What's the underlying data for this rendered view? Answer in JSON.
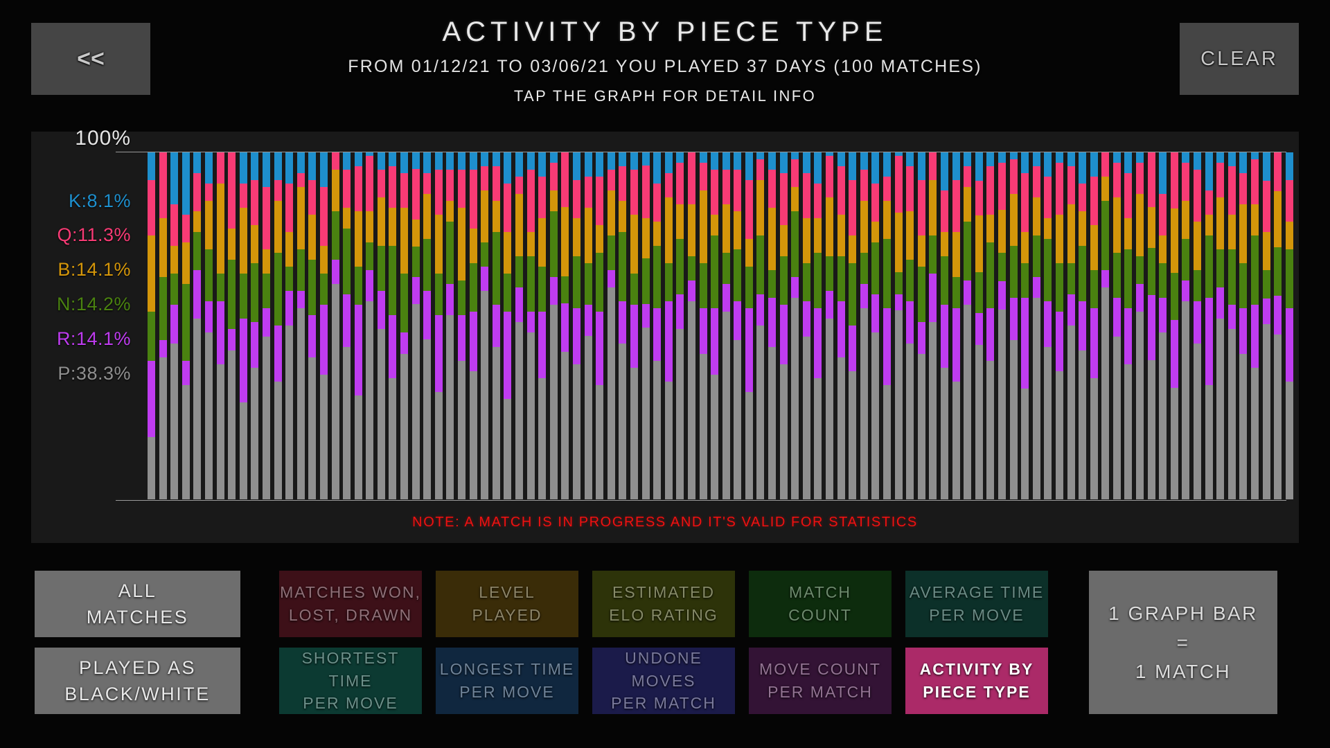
{
  "header": {
    "back_label": "<<",
    "clear_label": "CLEAR",
    "title": "ACTIVITY BY PIECE TYPE",
    "subtitle": "FROM 01/12/21 TO 03/06/21 YOU PLAYED 37 DAYS (100 MATCHES)",
    "hint": "TAP THE GRAPH FOR DETAIL INFO"
  },
  "chart": {
    "axis_top_label": "100%",
    "note": "NOTE: A MATCH IS IN PROGRESS AND IT'S VALID FOR STATISTICS"
  },
  "legend": [
    {
      "key": "K",
      "label": "K:8.1%",
      "color": "#1e8fcd",
      "name": "king"
    },
    {
      "key": "Q",
      "label": "Q:11.3%",
      "color": "#f83b75",
      "name": "queen"
    },
    {
      "key": "B",
      "label": "B:14.1%",
      "color": "#d4960a",
      "name": "bishop"
    },
    {
      "key": "N",
      "label": "N:14.2%",
      "color": "#4a8210",
      "name": "knight"
    },
    {
      "key": "R",
      "label": "R:14.1%",
      "color": "#bf3cf0",
      "name": "rook"
    },
    {
      "key": "P",
      "label": "P:38.3%",
      "color": "#8f8f8f",
      "name": "pawn"
    }
  ],
  "bottom_buttons": {
    "modes": [
      {
        "id": "all-matches",
        "lines": [
          "ALL",
          "MATCHES"
        ],
        "bg": "#6e6e6e",
        "fg": "#e8e8e8"
      },
      {
        "id": "played-as-color",
        "lines": [
          "PLAYED AS",
          "BLACK/WHITE"
        ],
        "bg": "#6e6e6e",
        "fg": "#e8e8e8"
      }
    ],
    "stats": [
      {
        "id": "matches-won-lost-drawn",
        "lines": [
          "MATCHES WON,",
          "LOST, DRAWN"
        ],
        "bg": "#3d1018",
        "fg": "#8f7078",
        "active": false
      },
      {
        "id": "level-played",
        "lines": [
          "LEVEL",
          "PLAYED"
        ],
        "bg": "#3a2c08",
        "fg": "#8c8468",
        "active": false
      },
      {
        "id": "estimated-elo-rating",
        "lines": [
          "ESTIMATED",
          "ELO RATING"
        ],
        "bg": "#2d3309",
        "fg": "#868a68",
        "active": false
      },
      {
        "id": "match-count",
        "lines": [
          "MATCH",
          "COUNT"
        ],
        "bg": "#0d2c0d",
        "fg": "#6d8a6d",
        "active": false
      },
      {
        "id": "average-time-per-move",
        "lines": [
          "AVERAGE TIME",
          "PER MOVE"
        ],
        "bg": "#0c3029",
        "fg": "#6b8b85",
        "active": false
      },
      {
        "id": "shortest-time-per-move",
        "lines": [
          "SHORTEST TIME",
          "PER MOVE"
        ],
        "bg": "#0c3a32",
        "fg": "#6d908a",
        "active": false
      },
      {
        "id": "longest-time-per-move",
        "lines": [
          "LONGEST TIME",
          "PER MOVE"
        ],
        "bg": "#10273f",
        "fg": "#6f8398",
        "active": false
      },
      {
        "id": "undone-moves-per-match",
        "lines": [
          "UNDONE MOVES",
          "PER MATCH"
        ],
        "bg": "#1b1b4a",
        "fg": "#7a7a9c",
        "active": false
      },
      {
        "id": "move-count-per-match",
        "lines": [
          "MOVE COUNT",
          "PER MATCH"
        ],
        "bg": "#331335",
        "fg": "#937493",
        "active": false
      },
      {
        "id": "activity-by-piece-type",
        "lines": [
          "ACTIVITY BY",
          "PIECE TYPE"
        ],
        "bg": "#ab2a68",
        "fg": "#ffffff",
        "active": true
      }
    ],
    "legend_box": {
      "id": "bar-legend",
      "lines": [
        "1 GRAPH BAR",
        "=",
        "1 MATCH"
      ]
    }
  },
  "chart_data": {
    "type": "bar",
    "stacked": true,
    "normalized": true,
    "title": "ACTIVITY BY PIECE TYPE",
    "subtitle": "FROM 01/12/21 TO 03/06/21 YOU PLAYED 37 DAYS (100 MATCHES)",
    "xlabel": "",
    "ylabel": "",
    "ylim": [
      0,
      100
    ],
    "grid": false,
    "legend_position": "left",
    "bar_count": 100,
    "bar_unit": "1 GRAPH BAR = 1 MATCH",
    "series_order": [
      "P",
      "R",
      "N",
      "B",
      "Q",
      "K"
    ],
    "series": [
      {
        "name": "P",
        "label": "P:38.3%",
        "color": "#8f8f8f",
        "total_pct": 38.3,
        "values": [
          18,
          41,
          45,
          33,
          52,
          48,
          39,
          43,
          28,
          38,
          47,
          34,
          50,
          55,
          41,
          36,
          62,
          44,
          30,
          57,
          49,
          35,
          42,
          58,
          46,
          31,
          53,
          40,
          37,
          60,
          44,
          29,
          51,
          48,
          35,
          56,
          43,
          39,
          47,
          33,
          61,
          45,
          38,
          52,
          40,
          34,
          49,
          57,
          42,
          36,
          54,
          46,
          31,
          50,
          44,
          39,
          58,
          47,
          35,
          52,
          41,
          37,
          55,
          48,
          33,
          60,
          45,
          42,
          51,
          38,
          34,
          56,
          49,
          40,
          53,
          46,
          32,
          58,
          44,
          37,
          50,
          43,
          35,
          61,
          47,
          39,
          54,
          41,
          48,
          36,
          57,
          45,
          33,
          52,
          49,
          42,
          38,
          55,
          47,
          34
        ]
      },
      {
        "name": "R",
        "label": "R:14.1%",
        "color": "#bf3cf0",
        "total_pct": 14.1,
        "values": [
          22,
          5,
          11,
          7,
          14,
          9,
          18,
          6,
          24,
          13,
          8,
          16,
          10,
          5,
          12,
          20,
          7,
          15,
          26,
          9,
          11,
          18,
          6,
          8,
          14,
          22,
          9,
          13,
          17,
          7,
          12,
          25,
          10,
          6,
          19,
          8,
          14,
          16,
          9,
          21,
          5,
          12,
          18,
          7,
          15,
          23,
          10,
          6,
          13,
          19,
          8,
          11,
          24,
          9,
          14,
          17,
          6,
          10,
          20,
          8,
          16,
          13,
          7,
          11,
          22,
          5,
          12,
          9,
          14,
          18,
          21,
          7,
          10,
          15,
          8,
          12,
          26,
          6,
          13,
          17,
          9,
          14,
          20,
          5,
          11,
          16,
          8,
          19,
          10,
          22,
          6,
          12,
          25,
          9,
          7,
          13,
          18,
          8,
          11,
          21
        ]
      },
      {
        "name": "N",
        "label": "N:14.2%",
        "color": "#4a8210",
        "total_pct": 14.2,
        "values": [
          14,
          18,
          9,
          22,
          11,
          15,
          8,
          20,
          13,
          17,
          10,
          21,
          7,
          12,
          16,
          9,
          14,
          19,
          11,
          8,
          13,
          20,
          17,
          9,
          15,
          12,
          18,
          10,
          14,
          7,
          21,
          11,
          9,
          16,
          13,
          19,
          8,
          15,
          12,
          17,
          10,
          20,
          9,
          14,
          18,
          11,
          16,
          7,
          13,
          21,
          9,
          15,
          12,
          17,
          8,
          14,
          19,
          11,
          16,
          10,
          13,
          18,
          9,
          15,
          20,
          7,
          12,
          16,
          11,
          14,
          9,
          17,
          13,
          19,
          8,
          15,
          10,
          12,
          18,
          14,
          9,
          16,
          11,
          20,
          13,
          17,
          8,
          14,
          10,
          15,
          12,
          9,
          18,
          11,
          16,
          13,
          20,
          9,
          14,
          17
        ]
      },
      {
        "name": "B",
        "label": "B:14.1%",
        "color": "#d4960a",
        "total_pct": 14.1,
        "values": [
          22,
          17,
          8,
          12,
          6,
          14,
          26,
          9,
          19,
          11,
          7,
          15,
          10,
          18,
          13,
          8,
          12,
          6,
          16,
          9,
          14,
          11,
          19,
          8,
          13,
          17,
          6,
          21,
          10,
          15,
          9,
          12,
          18,
          7,
          14,
          6,
          20,
          11,
          16,
          8,
          13,
          9,
          17,
          12,
          7,
          19,
          10,
          15,
          21,
          6,
          14,
          11,
          8,
          16,
          18,
          9,
          7,
          13,
          10,
          17,
          12,
          8,
          15,
          6,
          11,
          19,
          14,
          9,
          16,
          7,
          13,
          10,
          18,
          8,
          12,
          15,
          9,
          11,
          6,
          14,
          17,
          10,
          13,
          7,
          16,
          9,
          18,
          12,
          8,
          21,
          11,
          14,
          6,
          15,
          10,
          17,
          9,
          12,
          16,
          8
        ]
      },
      {
        "name": "Q",
        "label": "Q:11.3%",
        "color": "#f83b75",
        "total_pct": 11.3,
        "values": [
          16,
          19,
          12,
          8,
          11,
          5,
          9,
          22,
          7,
          13,
          18,
          6,
          14,
          4,
          10,
          17,
          5,
          11,
          13,
          16,
          8,
          12,
          10,
          15,
          6,
          13,
          9,
          11,
          17,
          7,
          10,
          14,
          5,
          18,
          12,
          8,
          16,
          11,
          9,
          14,
          6,
          10,
          13,
          16,
          11,
          7,
          12,
          15,
          8,
          13,
          10,
          12,
          17,
          6,
          11,
          15,
          8,
          13,
          10,
          12,
          14,
          16,
          9,
          11,
          7,
          18,
          13,
          16,
          8,
          12,
          15,
          6,
          11,
          14,
          13,
          10,
          17,
          9,
          12,
          15,
          11,
          8,
          14,
          7,
          10,
          13,
          9,
          16,
          12,
          18,
          11,
          15,
          7,
          10,
          14,
          9,
          13,
          16,
          11,
          12
        ]
      },
      {
        "name": "K",
        "label": "K:8.1%",
        "color": "#1e8fcd",
        "total_pct": 8.1,
        "values": [
          8,
          0,
          15,
          18,
          6,
          9,
          0,
          0,
          9,
          8,
          10,
          8,
          9,
          6,
          8,
          10,
          0,
          5,
          4,
          1,
          5,
          4,
          6,
          5,
          6,
          5,
          5,
          5,
          5,
          4,
          4,
          9,
          7,
          5,
          7,
          3,
          0,
          8,
          7,
          7,
          5,
          4,
          5,
          4,
          9,
          6,
          3,
          0,
          3,
          5,
          5,
          5,
          8,
          2,
          5,
          6,
          2,
          6,
          9,
          1,
          4,
          8,
          5,
          9,
          7,
          1,
          4,
          8,
          0,
          11,
          8,
          4,
          9,
          4,
          3,
          2,
          6,
          4,
          7,
          3,
          4,
          9,
          7,
          0,
          3,
          6,
          3,
          0,
          12,
          0,
          3,
          5,
          11,
          3,
          4,
          6,
          2,
          9,
          0,
          8
        ]
      }
    ]
  }
}
